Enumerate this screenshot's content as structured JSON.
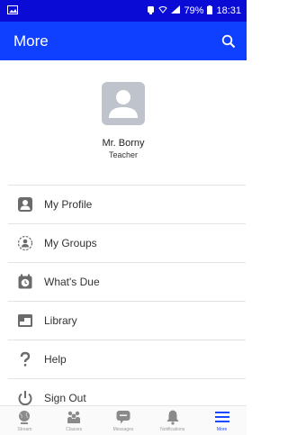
{
  "status_bar": {
    "battery": "79%",
    "time": "18:31"
  },
  "header": {
    "title": "More"
  },
  "profile": {
    "name": "Mr. Borny",
    "role": "Teacher"
  },
  "menu": [
    {
      "label": "My Profile",
      "icon": "user-card-icon"
    },
    {
      "label": "My Groups",
      "icon": "groups-icon"
    },
    {
      "label": "What's Due",
      "icon": "calendar-clock-icon"
    },
    {
      "label": "Library",
      "icon": "library-icon"
    },
    {
      "label": "Help",
      "icon": "question-mark-icon"
    },
    {
      "label": "Sign Out",
      "icon": "power-icon"
    }
  ],
  "bottom_nav": [
    {
      "label": "Stream",
      "icon": "globe-icon",
      "active": false
    },
    {
      "label": "Classes",
      "icon": "classes-icon",
      "active": false
    },
    {
      "label": "Messages",
      "icon": "chat-icon",
      "active": false
    },
    {
      "label": "Notifications",
      "icon": "bell-icon",
      "active": false
    },
    {
      "label": "More",
      "icon": "menu-icon",
      "active": true
    }
  ],
  "colors": {
    "status_bar": "#0b0bd6",
    "app_bar": "#0f3fff",
    "accent": "#1a48ff"
  }
}
